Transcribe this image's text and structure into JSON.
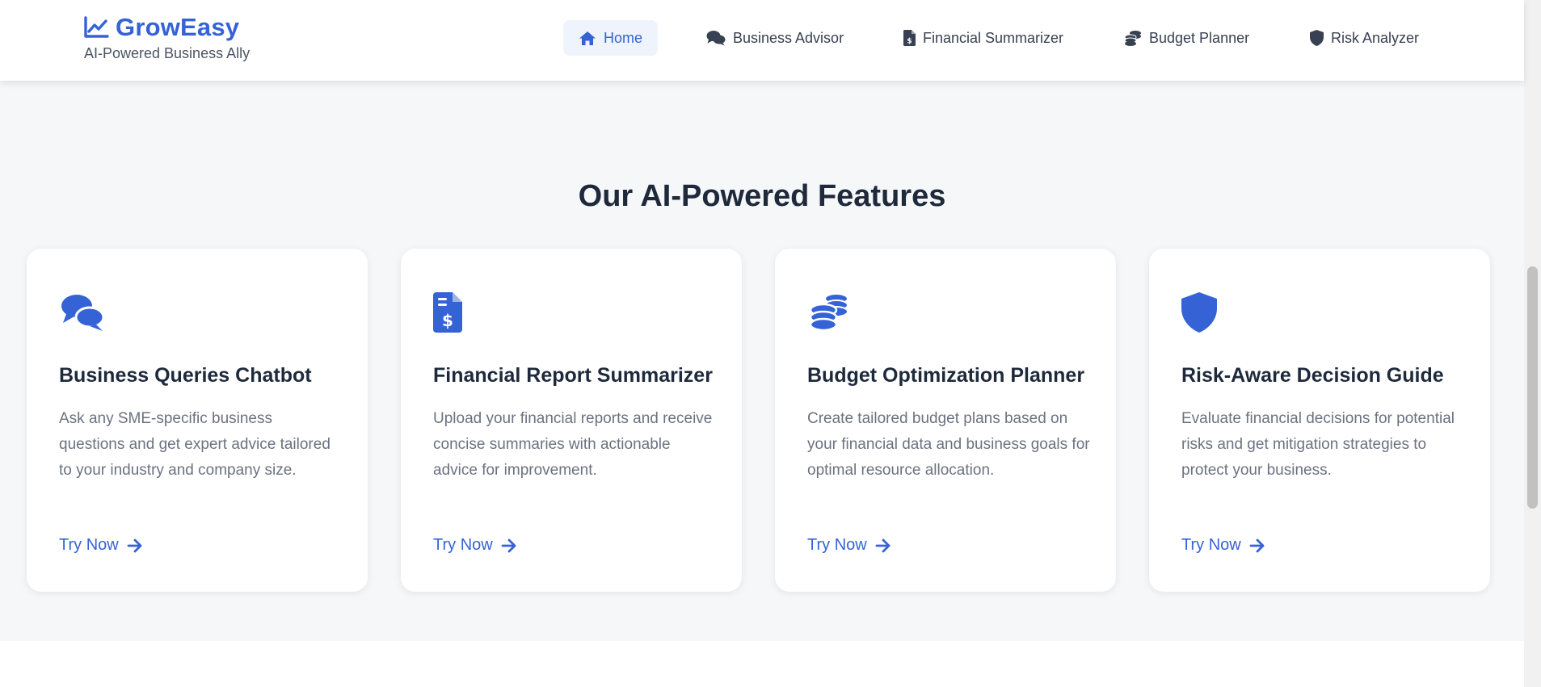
{
  "colors": {
    "accent": "#3563d6",
    "section_bg": "#f6f7f9",
    "heading": "#1e2a3b",
    "body_text": "#6b7280"
  },
  "brand": {
    "name": "GrowEasy",
    "tagline": "AI-Powered Business Ally",
    "icon": "chart-line-icon"
  },
  "nav": {
    "items": [
      {
        "label": "Home",
        "icon": "home-icon",
        "active": true
      },
      {
        "label": "Business Advisor",
        "icon": "comments-icon",
        "active": false
      },
      {
        "label": "Financial Summarizer",
        "icon": "file-invoice-dollar-icon",
        "active": false
      },
      {
        "label": "Budget Planner",
        "icon": "coins-icon",
        "active": false
      },
      {
        "label": "Risk Analyzer",
        "icon": "shield-icon",
        "active": false
      }
    ]
  },
  "features": {
    "title": "Our AI-Powered Features",
    "cards": [
      {
        "icon": "comments-icon",
        "title": "Business Queries Chatbot",
        "description": "Ask any SME-specific business questions and get expert advice tailored to your industry and company size.",
        "link": "Try Now"
      },
      {
        "icon": "file-invoice-dollar-icon",
        "title": "Financial Report Summarizer",
        "description": "Upload your financial reports and receive concise summaries with actionable advice for improvement.",
        "link": "Try Now"
      },
      {
        "icon": "coins-icon",
        "title": "Budget Optimization Planner",
        "description": "Create tailored budget plans based on your financial data and business goals for optimal resource allocation.",
        "link": "Try Now"
      },
      {
        "icon": "shield-icon",
        "title": "Risk-Aware Decision Guide",
        "description": "Evaluate financial decisions for potential risks and get mitigation strategies to protect your business.",
        "link": "Try Now"
      }
    ]
  }
}
